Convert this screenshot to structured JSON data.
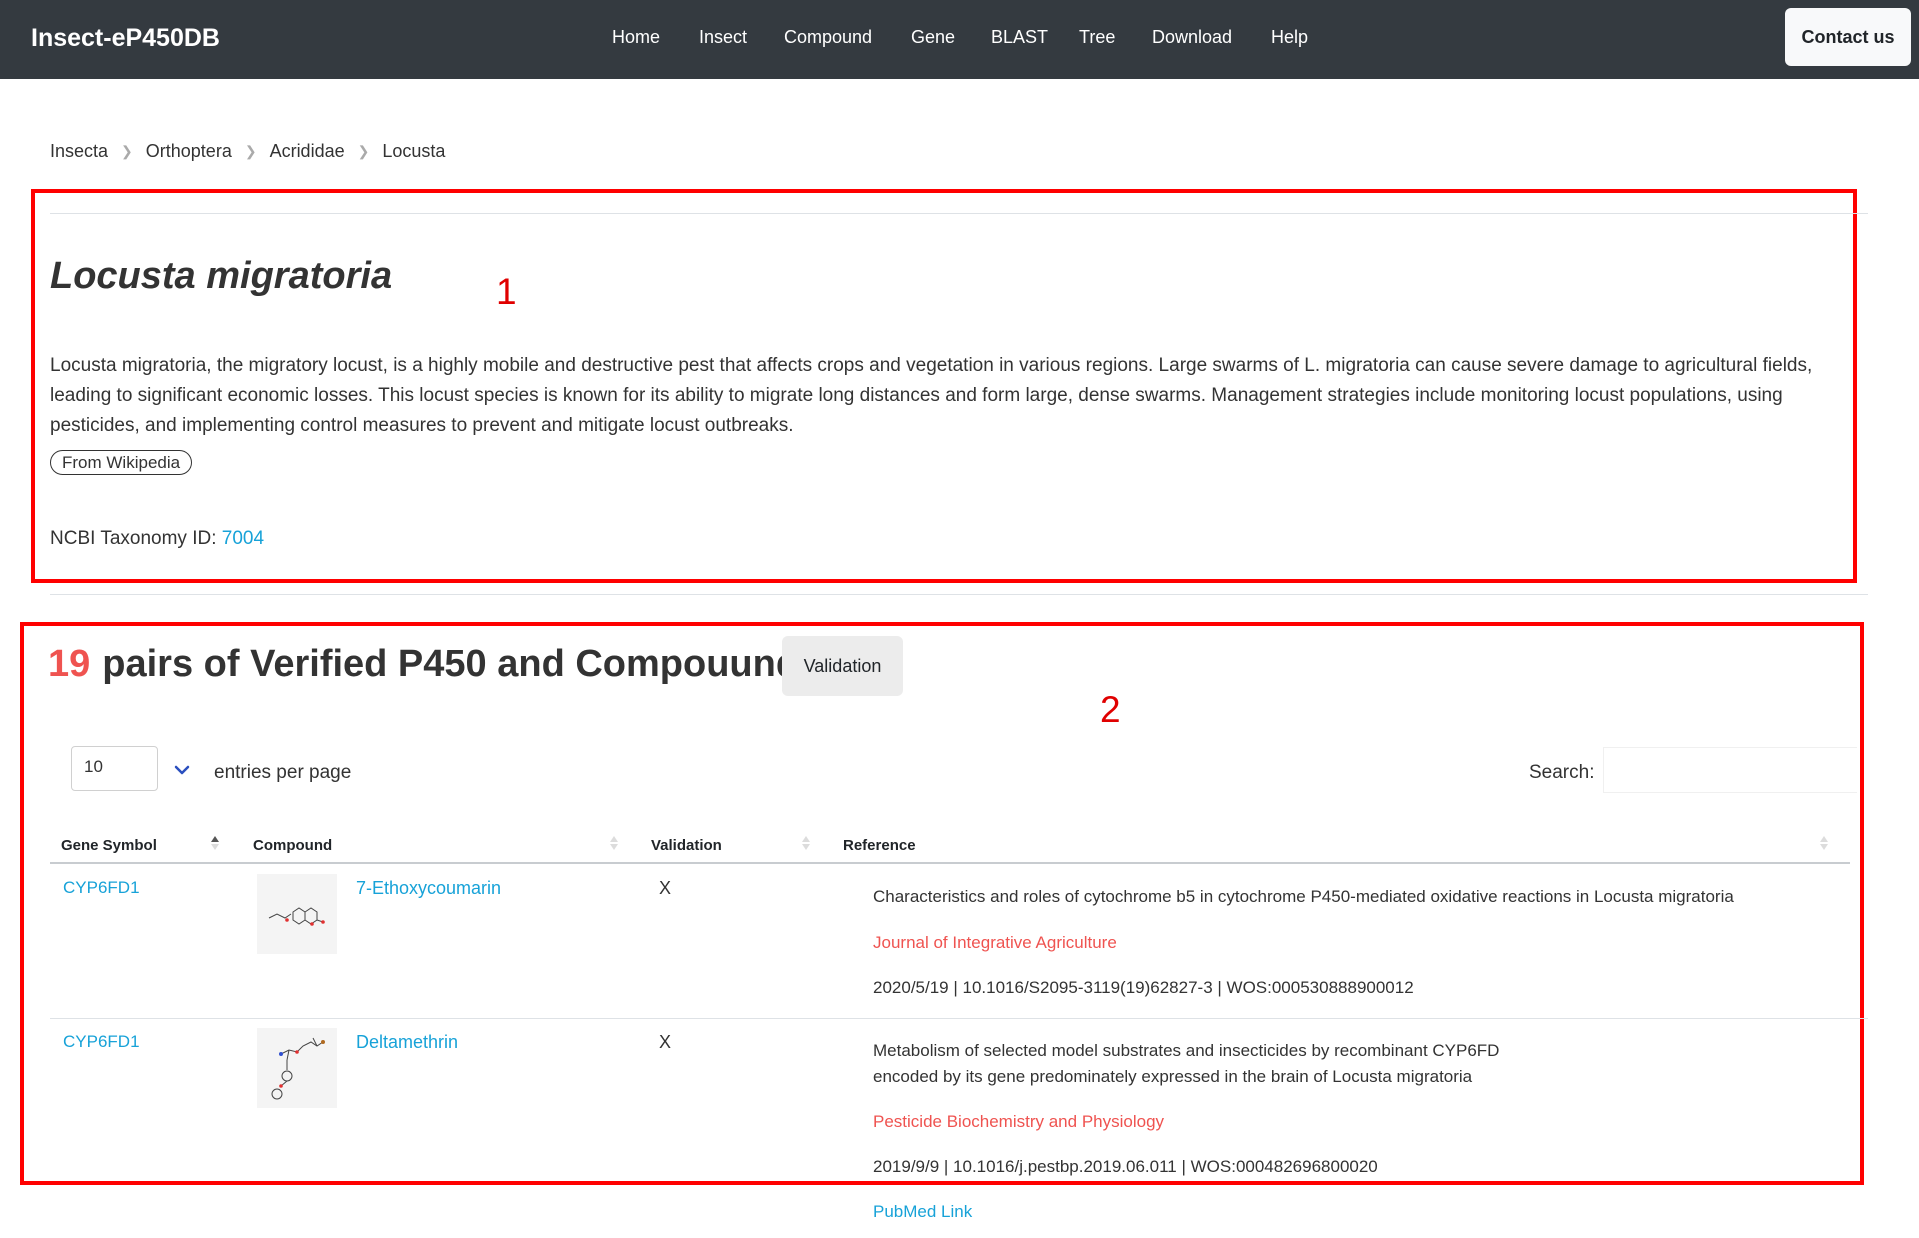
{
  "navbar": {
    "brand": "Insect-eP450DB",
    "items": [
      {
        "label": "Home"
      },
      {
        "label": "Insect"
      },
      {
        "label": "Compound"
      },
      {
        "label": "Gene"
      },
      {
        "label": "BLAST"
      },
      {
        "label": "Tree"
      },
      {
        "label": "Download"
      },
      {
        "label": "Help"
      }
    ],
    "contact_label": "Contact us"
  },
  "breadcrumb": [
    "Insecta",
    "Orthoptera",
    "Acrididae",
    "Locusta"
  ],
  "annotations": {
    "box1": "1",
    "box2": "2"
  },
  "species": {
    "title": "Locusta migratoria",
    "description": "Locusta migratoria, the migratory locust, is a highly mobile and destructive pest that affects crops and vegetation in various regions. Large swarms of L. migratoria can cause severe damage to agricultural fields, leading to significant economic losses. This locust species is known for its ability to migrate long distances and form large, dense swarms. Management strategies include monitoring locust populations, using pesticides, and implementing control measures to prevent and mitigate locust outbreaks.",
    "wiki_label": "From Wikipedia",
    "ncbi_label": "NCBI Taxonomy ID:",
    "ncbi_id": "7004"
  },
  "pairs": {
    "count": "19",
    "heading": "pairs of Verified P450 and Compouunds",
    "validation_button": "Validation"
  },
  "table_controls": {
    "entries_value": "10",
    "entries_label": "entries per page",
    "search_label": "Search:",
    "search_value": ""
  },
  "table": {
    "headers": [
      "Gene Symbol",
      "Compound",
      "Validation",
      "Reference"
    ],
    "rows": [
      {
        "gene": "CYP6FD1",
        "compound": "7-Ethoxycoumarin",
        "validation": "X",
        "ref_title_1": "Characteristics and roles of cytochrome b5 in cytochrome P450-mediated oxidative reactions in Locusta migratoria",
        "ref_title_2": "",
        "journal": "Journal of Integrative Agriculture",
        "meta": "2020/5/19 | 10.1016/S2095-3119(19)62827-3 | WOS:000530888900012",
        "pubmed": ""
      },
      {
        "gene": "CYP6FD1",
        "compound": "Deltamethrin",
        "validation": "X",
        "ref_title_1": "Metabolism of selected model substrates and insecticides by recombinant CYP6FD",
        "ref_title_2": "encoded by its gene predominately expressed in the brain of Locusta migratoria",
        "journal": "Pesticide Biochemistry and Physiology",
        "meta": "2019/9/9 | 10.1016/j.pestbp.2019.06.011 | WOS:000482696800020",
        "pubmed": "PubMed Link"
      }
    ]
  },
  "colors": {
    "navbar": "#343a40",
    "link": "#17a2d8",
    "accent_red": "#ef5350",
    "annotation": "#ff0000"
  }
}
